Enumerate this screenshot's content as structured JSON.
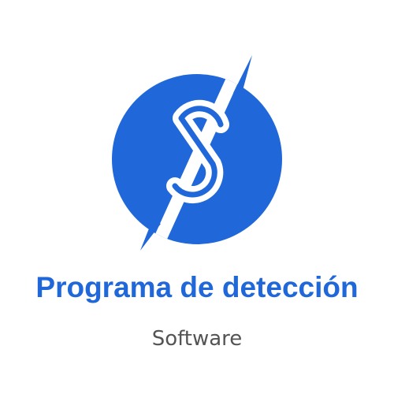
{
  "brand": {
    "name": "Programa de detección",
    "tagline": "Software",
    "logo_icon": "s-lightning-circle-icon"
  },
  "colors": {
    "primary": "#2068DA",
    "tagline": "#545454",
    "background": "#FFFFFF"
  }
}
